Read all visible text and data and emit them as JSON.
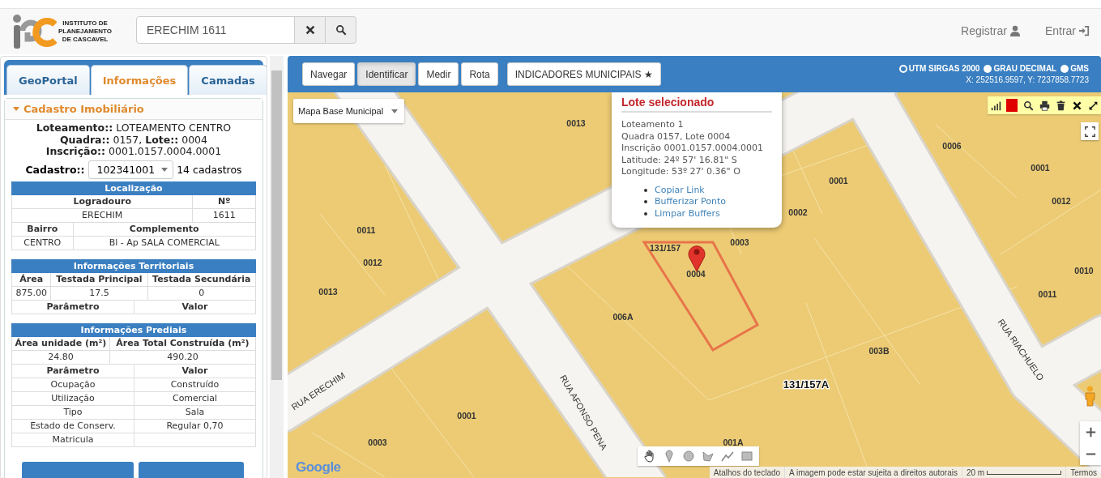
{
  "header": {
    "logo_text": [
      "INSTITUTO DE",
      "PLANEJAMENTO",
      "DE CASCAVEL"
    ],
    "search": {
      "value": "ERECHIM 1611"
    },
    "links": [
      {
        "label": "Registrar",
        "kind": "register"
      },
      {
        "label": "Entrar",
        "kind": "login"
      }
    ]
  },
  "sidebar": {
    "tabs": [
      {
        "label": "GeoPortal",
        "selected": false
      },
      {
        "label": "Informações",
        "selected": true
      },
      {
        "label": "Camadas",
        "selected": false
      }
    ],
    "section": {
      "title": "Cadastro Imobiliário",
      "expanded": true,
      "summary": [
        "**Loteamento::** LOTEAMENTO CENTRO",
        "**Quadra::** 0157, **Lote::** 0004",
        "**Inscrição::** 0001.0157.0004.0001"
      ],
      "cadastro": {
        "label": "Cadastro::",
        "value": "102341001",
        "count": "14 cadastros"
      },
      "tables": [
        {
          "title": "Localização",
          "rows": [
            {
              "kind": "head",
              "cells": [
                "Logradouro",
                "Nº"
              ]
            },
            {
              "kind": "data",
              "cells": [
                "ERECHIM",
                "1611"
              ]
            },
            {
              "kind": "head",
              "cells": [
                "Bairro",
                "Complemento"
              ]
            },
            {
              "kind": "data",
              "cells": [
                "CENTRO",
                "Bl - Ap SALA COMERCIAL"
              ]
            }
          ]
        },
        {
          "title": "Informações Territoriais",
          "rows": [
            {
              "kind": "head",
              "cells": [
                "Área",
                "Testada Principal",
                "Testada Secundária"
              ]
            },
            {
              "kind": "data",
              "cells": [
                "875.00",
                "17.5",
                "0"
              ]
            }
          ]
        },
        {
          "rows": [
            {
              "kind": "head",
              "cells": [
                "Parâmetro",
                "Valor"
              ]
            }
          ]
        },
        {
          "title": "Informações Prediais",
          "rows": [
            {
              "kind": "head",
              "cells": [
                "Área unidade (m²)",
                "Área Total Construída (m²)"
              ]
            },
            {
              "kind": "data",
              "cells": [
                "24.80",
                "490.20"
              ]
            },
            {
              "kind": "head",
              "cells": [
                "Parâmetro",
                "Valor"
              ]
            },
            {
              "kind": "data",
              "cells": [
                "Ocupação",
                "Construído"
              ]
            },
            {
              "kind": "data",
              "cells": [
                "Utilização",
                "Comercial"
              ]
            },
            {
              "kind": "data",
              "cells": [
                "Tipo",
                "Sala"
              ]
            },
            {
              "kind": "data",
              "cells": [
                "Estado de Conserv.",
                "Regular 0,70"
              ]
            },
            {
              "kind": "data",
              "cells": [
                "Matricula"
              ]
            }
          ]
        }
      ]
    }
  },
  "map": {
    "tools": [
      {
        "label": "Navegar",
        "selected": false
      },
      {
        "label": "Identificar",
        "selected": true
      },
      {
        "label": "Medir",
        "selected": false
      },
      {
        "label": "Rota",
        "selected": false
      }
    ],
    "indicators": "INDICADORES MUNICIPAIS ★",
    "projections": [
      {
        "label": "UTM SIRGAS 2000",
        "selected": true
      },
      {
        "label": "GRAU DECIMAL",
        "selected": false
      },
      {
        "label": "GMS",
        "selected": false
      }
    ],
    "coordinates": "X: 252516.9597, Y: 7237858.7723",
    "base_layer": "Mapa Base Municipal",
    "popup": {
      "title": "Lote selecionado",
      "lines": [
        "Loteamento 1",
        "Quadra 0157, Lote 0004",
        "Inscrição 0001.0157.0004.0001",
        "Latitude: 24º 57' 16.81\" S",
        "Longitude: 53º 27' 0.36\" O"
      ],
      "links": [
        "Copiar Link",
        "Bufferizar Ponto",
        "Limpar Buffers"
      ]
    },
    "lot_labels": [
      "0013",
      "0006",
      "0001",
      "0001",
      "0012",
      "0002",
      "0011",
      "0003",
      "131/157",
      "0012",
      "0010",
      "0004",
      "0013",
      "0011",
      "006A",
      "003B",
      "131/157A",
      "0001",
      "0003",
      "001A"
    ],
    "street_labels": [
      "RUA ERECHIM",
      "RUA AFONSO PENA",
      "RUA RIACHUELO"
    ],
    "logo": "Google",
    "attribution": [
      "Atalhos do teclado",
      "A imagem pode estar sujeita a direitos autorais"
    ],
    "scale": "20 m",
    "terms": "Termos"
  }
}
